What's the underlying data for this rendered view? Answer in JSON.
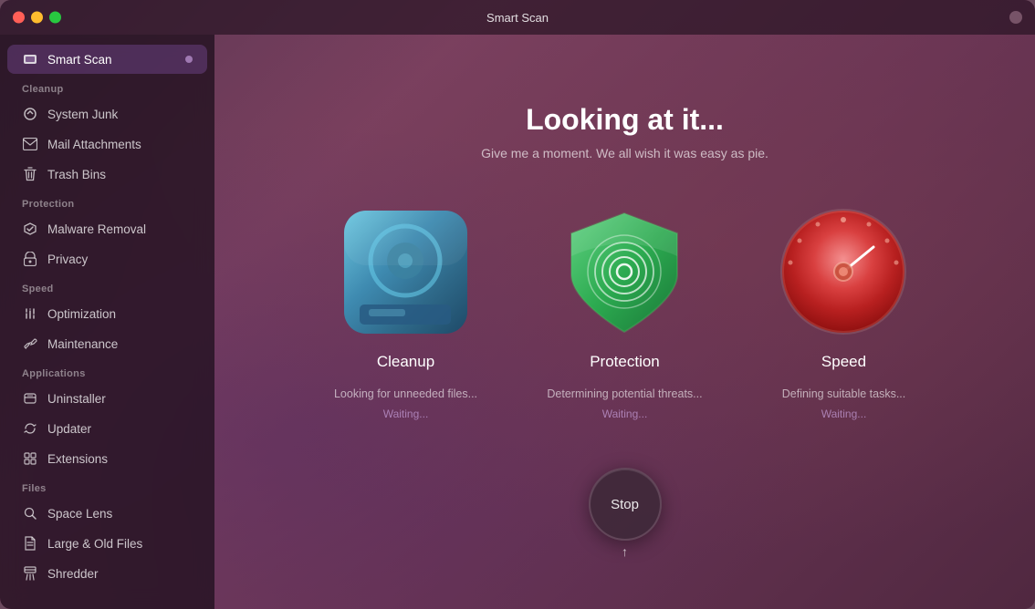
{
  "window": {
    "title": "Smart Scan",
    "traffic_lights": {
      "close": "close",
      "minimize": "minimize",
      "maximize": "maximize"
    }
  },
  "sidebar": {
    "active_item": "smart-scan",
    "top_item": {
      "label": "Smart Scan",
      "badge": true
    },
    "sections": [
      {
        "label": "Cleanup",
        "items": [
          {
            "id": "system-junk",
            "label": "System Junk",
            "icon": "⚙"
          },
          {
            "id": "mail-attachments",
            "label": "Mail Attachments",
            "icon": "✉"
          },
          {
            "id": "trash-bins",
            "label": "Trash Bins",
            "icon": "🗑"
          }
        ]
      },
      {
        "label": "Protection",
        "items": [
          {
            "id": "malware-removal",
            "label": "Malware Removal",
            "icon": "✳"
          },
          {
            "id": "privacy",
            "label": "Privacy",
            "icon": "✋"
          }
        ]
      },
      {
        "label": "Speed",
        "items": [
          {
            "id": "optimization",
            "label": "Optimization",
            "icon": "⚡"
          },
          {
            "id": "maintenance",
            "label": "Maintenance",
            "icon": "🔧"
          }
        ]
      },
      {
        "label": "Applications",
        "items": [
          {
            "id": "uninstaller",
            "label": "Uninstaller",
            "icon": "📦"
          },
          {
            "id": "updater",
            "label": "Updater",
            "icon": "🔄"
          },
          {
            "id": "extensions",
            "label": "Extensions",
            "icon": "🧩"
          }
        ]
      },
      {
        "label": "Files",
        "items": [
          {
            "id": "space-lens",
            "label": "Space Lens",
            "icon": "🔍"
          },
          {
            "id": "large-old-files",
            "label": "Large & Old Files",
            "icon": "📁"
          },
          {
            "id": "shredder",
            "label": "Shredder",
            "icon": "🗂"
          }
        ]
      }
    ]
  },
  "main": {
    "heading": "Looking at it...",
    "subheading": "Give me a moment. We all wish it was easy as pie.",
    "cards": [
      {
        "id": "cleanup",
        "label": "Cleanup",
        "status": "Looking for unneeded files...",
        "waiting": "Waiting..."
      },
      {
        "id": "protection",
        "label": "Protection",
        "status": "Determining potential threats...",
        "waiting": "Waiting..."
      },
      {
        "id": "speed",
        "label": "Speed",
        "status": "Defining suitable tasks...",
        "waiting": "Waiting..."
      }
    ],
    "stop_button_label": "Stop"
  }
}
